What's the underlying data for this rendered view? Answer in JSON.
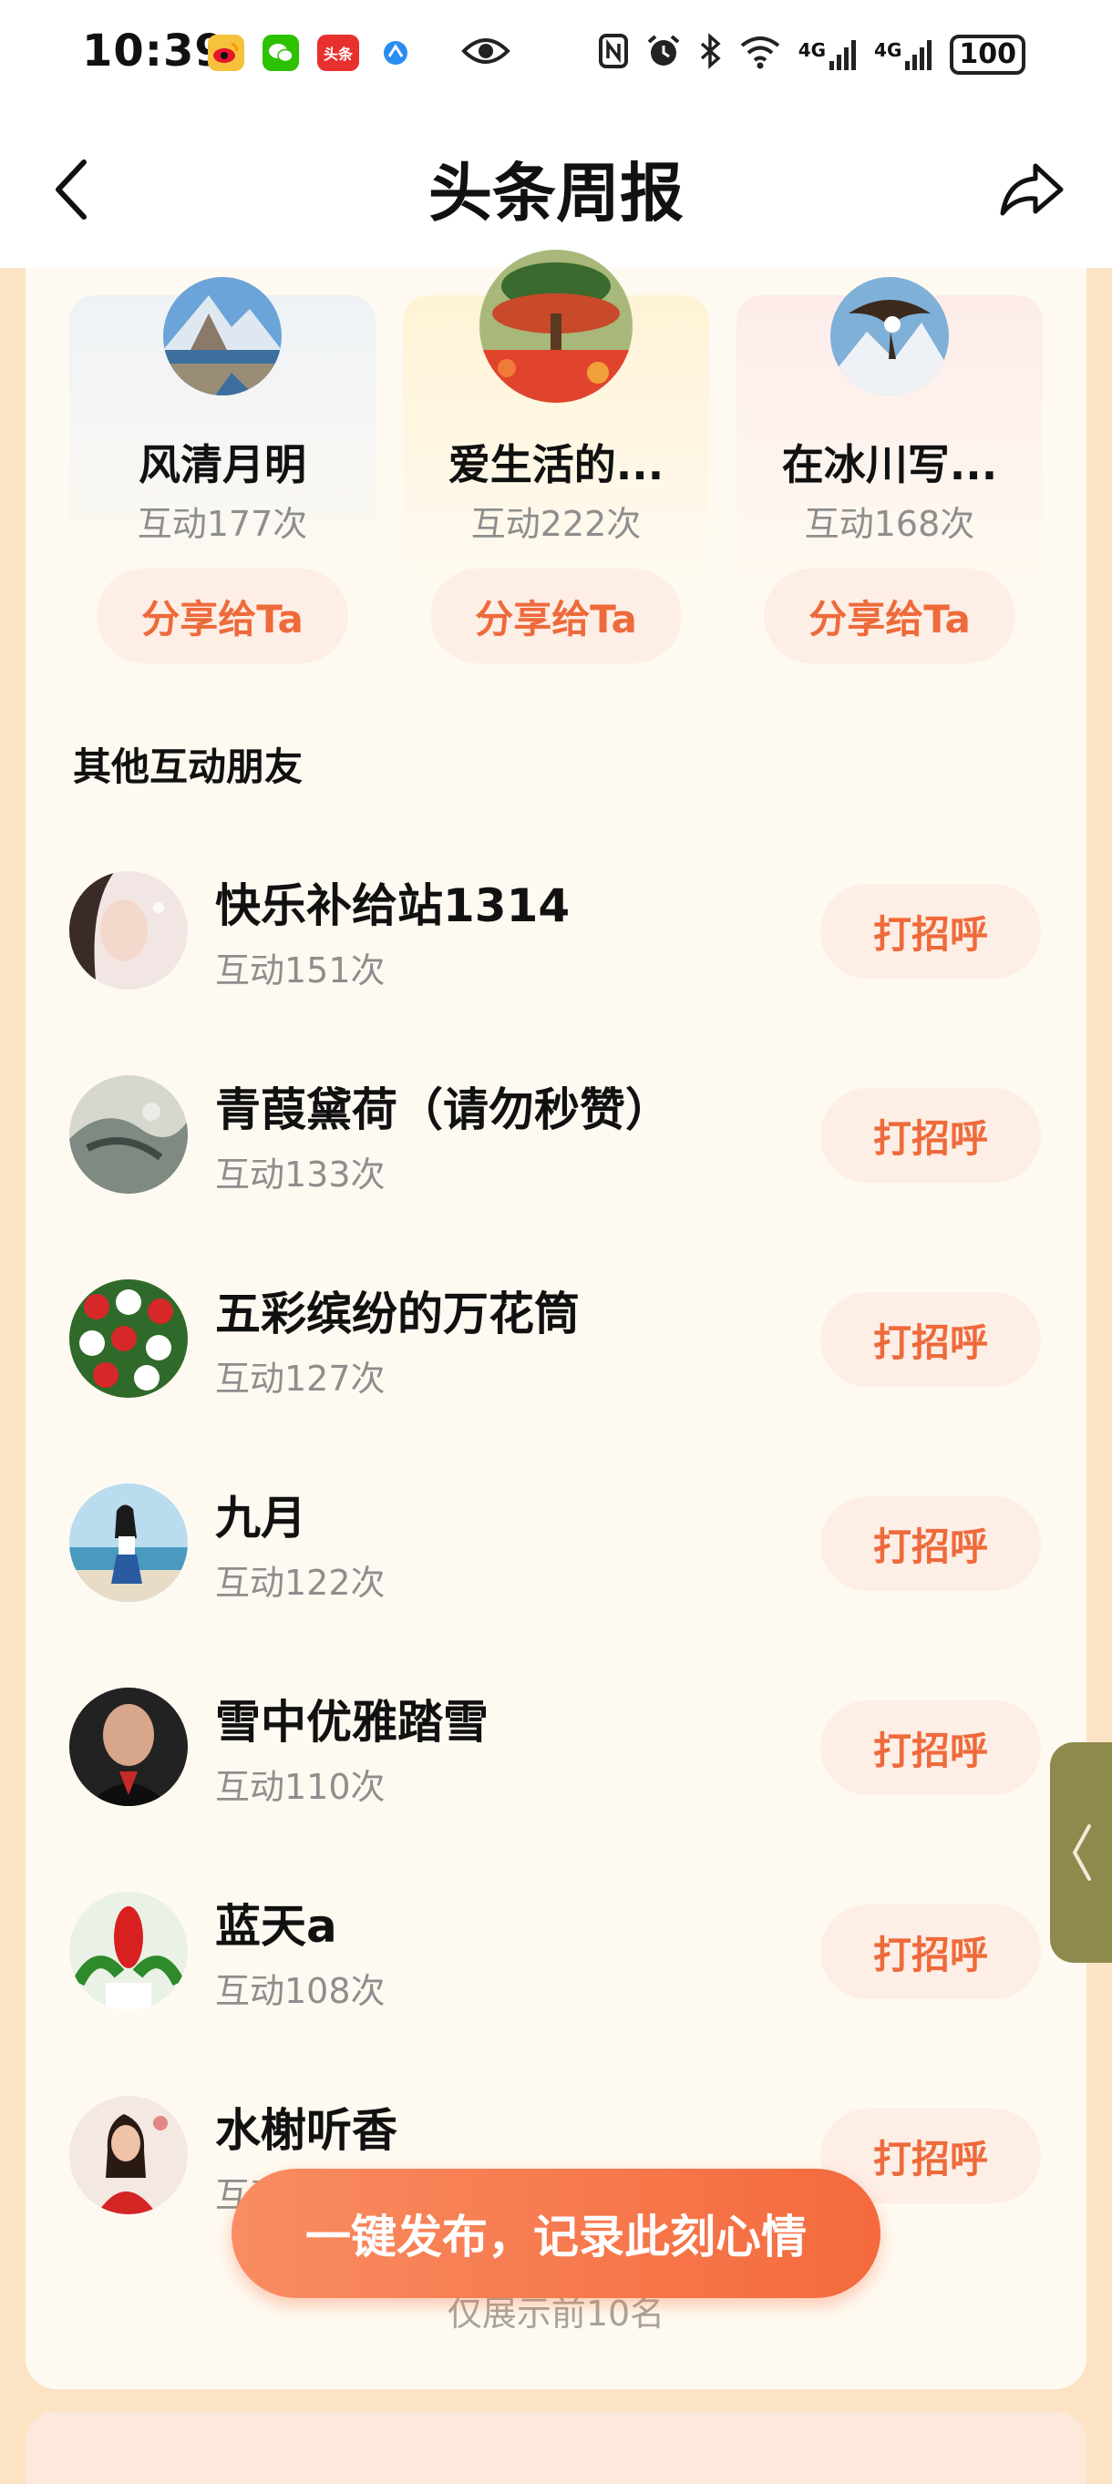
{
  "status_bar": {
    "time": "10:39",
    "app_icons": [
      "weibo-icon",
      "wechat-icon",
      "toutiao-icon",
      "browser-icon"
    ],
    "toutiao_icon_text": "头条",
    "network_1": "4G",
    "network_2": "4G",
    "battery": "100"
  },
  "header": {
    "title": "头条周报",
    "back_icon": "chevron-left-icon",
    "share_icon": "share-arrow-icon"
  },
  "top_friends": [
    {
      "name": "风清月明",
      "count": "互动177次",
      "share_label": "分享给Ta"
    },
    {
      "name": "爱生活的...",
      "count": "互动222次",
      "share_label": "分享给Ta"
    },
    {
      "name": "在冰川写...",
      "count": "互动168次",
      "share_label": "分享给Ta"
    }
  ],
  "other_friends": {
    "title": "其他互动朋友",
    "greet_label": "打招呼",
    "items": [
      {
        "name": "快乐补给站1314",
        "count": "互动151次"
      },
      {
        "name": "青葭黛荷（请勿秒赞）",
        "count": "互动133次"
      },
      {
        "name": "五彩缤纷的万花筒",
        "count": "互动127次"
      },
      {
        "name": "九月",
        "count": "互动122次"
      },
      {
        "name": "雪中优雅踏雪",
        "count": "互动110次"
      },
      {
        "name": "蓝天a",
        "count": "互动108次"
      },
      {
        "name": "水榭听香",
        "count": "互动91次"
      }
    ]
  },
  "footnote": "仅展示前10名",
  "publish_button": "一键发布，记录此刻心情",
  "colors": {
    "accent": "#ee6a3b",
    "button_bg": "#fdeee6",
    "page_bg": "#fbe3c3",
    "card_bg": "#fffaf1",
    "side_tab": "#8e8a4d"
  }
}
